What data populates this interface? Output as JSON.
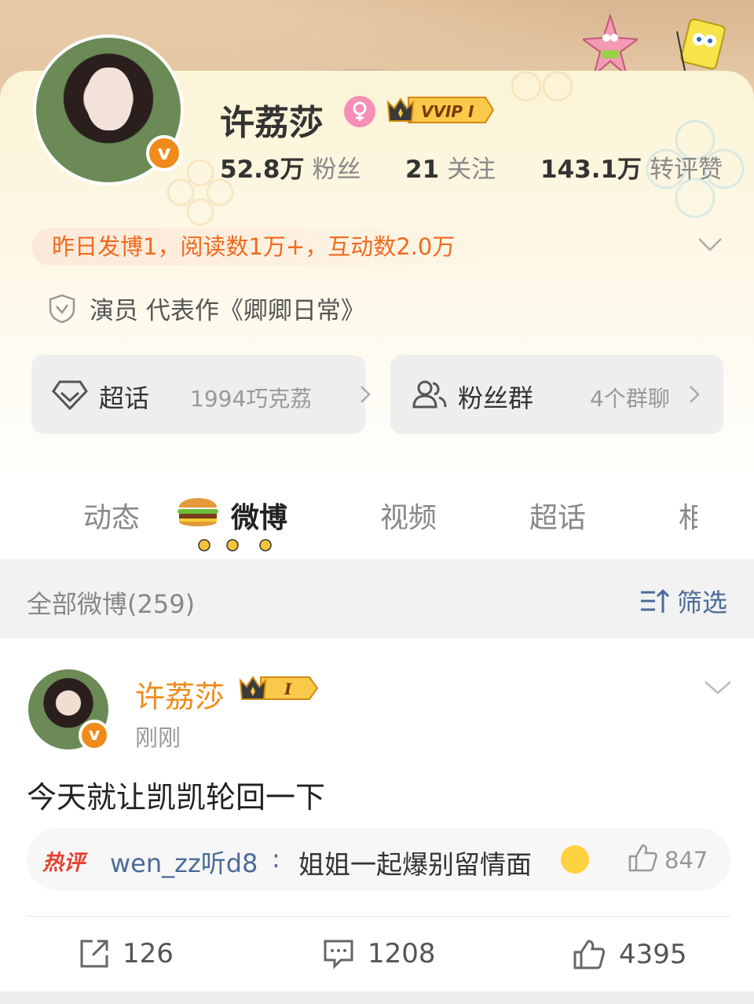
{
  "profile": {
    "name": "许荔莎",
    "badge": "VVIP I",
    "stats": [
      {
        "value": "52.8万",
        "label": "粉丝"
      },
      {
        "value": "21",
        "label": "关注"
      },
      {
        "value": "143.1万",
        "label": "转评赞"
      }
    ],
    "activity": "昨日发博1，阅读数1万+，互动数2.0万",
    "cert": "演员 代表作《卿卿日常》"
  },
  "pills": [
    {
      "label": "超话",
      "sub": "1994巧克荔"
    },
    {
      "label": "粉丝群",
      "sub": "4个群聊"
    }
  ],
  "tabs": [
    "动态",
    "微博",
    "视频",
    "超话",
    "相"
  ],
  "filter": {
    "count": "全部微博(259)",
    "button": "筛选"
  },
  "post": {
    "name": "许荔莎",
    "badge": "I",
    "time": "刚刚",
    "text": "今天就让凯凯轮回一下",
    "hot_tag": "热评",
    "hot_user": "wen_zz听d8",
    "hot_sep": ":",
    "hot_comment": "姐姐一起爆别留情面",
    "hot_likes": "847",
    "reposts": "126",
    "comments": "1208",
    "likes": "4395"
  },
  "colors": {
    "accent": "#f08b1b",
    "link": "#4a6b99",
    "activity_text": "#f06a1e",
    "hot_tag": "#e5412e"
  }
}
